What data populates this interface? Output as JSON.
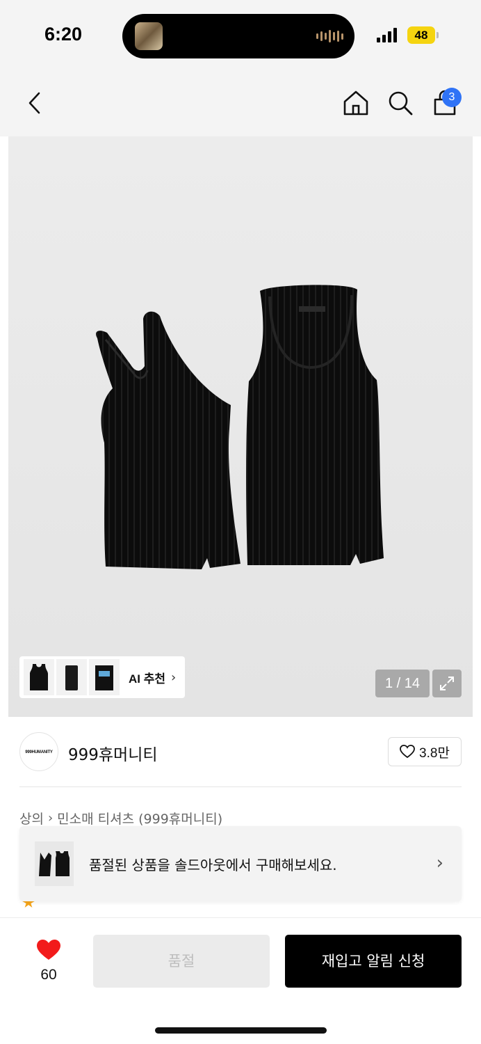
{
  "status_bar": {
    "time": "6:20",
    "battery": "48"
  },
  "nav": {
    "cart_count": "3"
  },
  "gallery": {
    "ai_label": "AI 추천",
    "page_counter": "1 / 14"
  },
  "brand": {
    "logo_text": "999HUMANITY",
    "name": "999휴머니티",
    "likes": "3.8만"
  },
  "breadcrumb": {
    "category": "상의",
    "subcategory": "민소매 티셔츠 (999휴머니티)"
  },
  "banner": {
    "text": "품절된 상품을 솔드아웃에서 구매해보세요."
  },
  "bottom": {
    "wish_count": "60",
    "soldout_label": "품절",
    "restock_label": "재입고 알림 신청"
  },
  "colors": {
    "accent_blue": "#2f73f6",
    "heart_red": "#f21b1b",
    "battery_yellow": "#f5d410"
  }
}
